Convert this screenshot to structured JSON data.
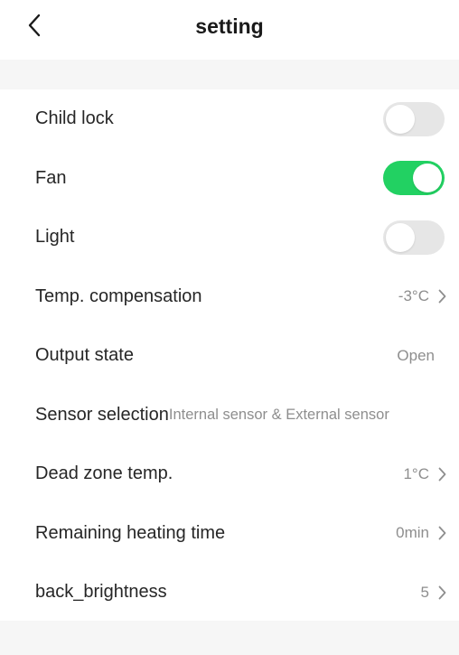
{
  "header": {
    "title": "setting"
  },
  "rows": [
    {
      "label": "Child lock",
      "type": "toggle",
      "on": false
    },
    {
      "label": "Fan",
      "type": "toggle",
      "on": true
    },
    {
      "label": "Light",
      "type": "toggle",
      "on": false
    },
    {
      "label": "Temp. compensation",
      "type": "value",
      "value": "-3°C",
      "chevron": true
    },
    {
      "label": "Output state",
      "type": "value",
      "value": "Open",
      "chevron": false
    },
    {
      "label": "Sensor selection",
      "type": "value",
      "value": "Internal sensor & External sensor",
      "chevron": false
    },
    {
      "label": "Dead zone temp.",
      "type": "value",
      "value": "1°C",
      "chevron": true
    },
    {
      "label": "Remaining heating time",
      "type": "value",
      "value": "0min",
      "chevron": true
    },
    {
      "label": "back_brightness",
      "type": "value",
      "value": "5",
      "chevron": true
    }
  ],
  "colors": {
    "toggle_on": "#22d162",
    "toggle_off": "#e6e6e6",
    "band": "#f6f6f6",
    "value_text": "#8e8e8e"
  }
}
